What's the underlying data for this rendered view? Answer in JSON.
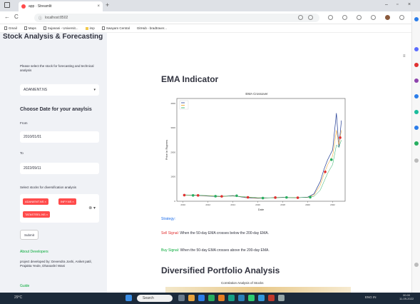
{
  "browser": {
    "tab_title": "app · Streamlit",
    "tab_close": "×",
    "new_tab": "+",
    "url": "localhost:8502",
    "nav": {
      "back": "←",
      "reload": "C",
      "info": "ⓘ"
    },
    "window": {
      "minimize": "–",
      "restore": "▫",
      "close": "×"
    },
    "bookmarks": [
      "Gmail",
      "Maps",
      "Sujanani - Universit...",
      "imp",
      "Swayam Central",
      "GitHub - bradtraver..."
    ]
  },
  "sidebar": {
    "title": "Stock Analysis & Forecasting",
    "prompt": "Please select the stock for forecasting and technical analysis",
    "stock_select": {
      "value": "ADANIENT.NS",
      "chevron": "▾"
    },
    "date_heading": "Choose Date for your anaylsis",
    "from_label": "From",
    "from_value": "2010/01/01",
    "to_label": "To",
    "to_value": "2022/09/11",
    "diversify_label": "Select stocks for diversification analysis",
    "chips": [
      "ADANIENT.NS ×",
      "INFY.NS ×",
      "TATASTEEL.NS ×"
    ],
    "clear_icon": "⊗ ▾",
    "submit": "Submit",
    "about_link": "About Developers",
    "credits": "project developed by: Devendra Joshi, Aniket patil, Prajakta Yeole, Dhanashri Wani",
    "guide_link": "Guide"
  },
  "main": {
    "menu_icon": "≡",
    "ema_heading": "EMA Indicator",
    "strategy_label": "Strategy:",
    "sell_label": "Sell Signal:",
    "sell_text": " When the 50-day EMA crosses below the 200-day EMA.",
    "buy_label": "Buy Signal:",
    "buy_text": " When the 50-day EMA crosses above the 200-day EMA.",
    "diversified_heading": "Diversified Portfolio Analysis",
    "correlation_title": "Correlation Analysis of Stocks"
  },
  "chart_data": {
    "type": "line",
    "title": "EMA Crossover",
    "xlabel": "Date",
    "ylabel": "Price in Rupees",
    "legend_placement": "top-left",
    "grid": false,
    "x": [
      2010,
      2011,
      2012,
      2013,
      2014,
      2015,
      2016,
      2017,
      2018,
      2019,
      2020,
      2020.5,
      2021,
      2021.3,
      2021.6,
      2022,
      2022.3,
      2022.5,
      2022.7
    ],
    "xlim": [
      2009.5,
      2023
    ],
    "ylim": [
      0,
      4200
    ],
    "series": [
      {
        "values": [
          260,
          240,
          210,
          190,
          230,
          150,
          120,
          140,
          160,
          140,
          170,
          300,
          800,
          1300,
          1700,
          2100,
          3600,
          2200,
          3300
        ],
        "color": "#1f3a93"
      },
      {
        "values": [
          255,
          245,
          220,
          195,
          220,
          165,
          130,
          140,
          155,
          145,
          160,
          250,
          650,
          1100,
          1500,
          1850,
          2900,
          2300,
          2900
        ],
        "color": "#f39c12"
      },
      {
        "values": [
          250,
          250,
          230,
          205,
          210,
          180,
          145,
          140,
          150,
          148,
          155,
          200,
          450,
          800,
          1150,
          1500,
          2300,
          2200,
          2500
        ],
        "color": "#27ae60"
      }
    ],
    "sell_markers": [
      [
        2010.1,
        250
      ],
      [
        2011.2,
        240
      ],
      [
        2013.1,
        200
      ],
      [
        2015.2,
        160
      ],
      [
        2017.4,
        150
      ],
      [
        2019.2,
        145
      ],
      [
        2021.4,
        1200
      ],
      [
        2022.6,
        2600
      ]
    ],
    "buy_markers": [
      [
        2010.8,
        240
      ],
      [
        2012.6,
        205
      ],
      [
        2014.3,
        225
      ],
      [
        2016.4,
        130
      ],
      [
        2018.3,
        155
      ],
      [
        2020.2,
        165
      ],
      [
        2021.9,
        1700
      ]
    ],
    "x_ticks": [
      "2010",
      "2012",
      "2014",
      "2016",
      "2018",
      "2020",
      "2022"
    ],
    "y_ticks": [
      "0",
      "1000",
      "2000",
      "3000",
      "4000"
    ]
  },
  "taskbar": {
    "weather": "29°C",
    "search": "Search",
    "tray": "ENG  IN",
    "time": "00:00",
    "date": "11-09-2022"
  },
  "colors": {
    "accent": "#ff4b4b",
    "success": "#09ab3b",
    "sidebar_bg": "#f0f2f6"
  }
}
